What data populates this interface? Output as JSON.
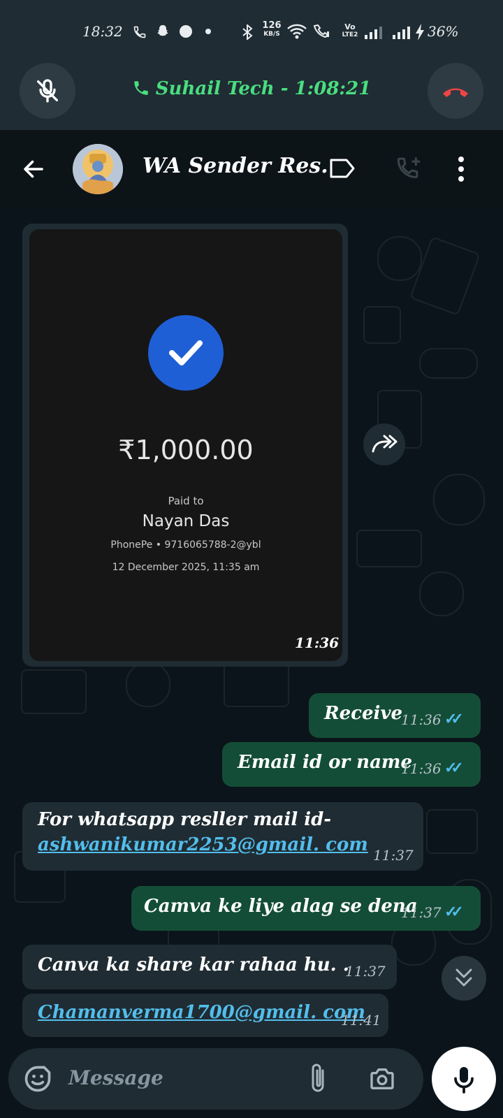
{
  "status_bar": {
    "time": "18:32",
    "net_speed_top": "126",
    "net_speed_unit": "KB/S",
    "volte_top": "Vo",
    "volte_bottom": "LTE2",
    "battery": "36%"
  },
  "call_banner": {
    "label": "Suhail Tech - 1:08:21"
  },
  "app_bar": {
    "title": "WA Sender Res."
  },
  "receipt": {
    "amount": "₹1,000.00",
    "paid_to_label": "Paid to",
    "payee": "Nayan Das",
    "upi": "PhonePe • 9716065788-2@ybl",
    "datetime": "12 December 2025, 11:35 am",
    "time": "11:36"
  },
  "messages": [
    {
      "direction": "out",
      "text": "Receive",
      "time": "11:36",
      "status": "read"
    },
    {
      "direction": "out",
      "text": "Email id or name",
      "time": "11:36",
      "status": "read"
    },
    {
      "direction": "in",
      "text": "For whatsapp resller mail id-",
      "link": "ashwanikumar2253@gmail. com",
      "time": "11:37"
    },
    {
      "direction": "out",
      "text": "Camva ke liye alag se dena",
      "time": "11:37",
      "status": "read"
    },
    {
      "direction": "in",
      "text": "Canva ka share kar rahaa hu. .",
      "time": "11:37"
    },
    {
      "direction": "in",
      "link": "Chamanverma1700@gmail. com",
      "time": "11:41"
    }
  ],
  "input": {
    "placeholder": "Message"
  },
  "colors": {
    "incoming_bubble": "#1f2c33",
    "outgoing_bubble": "#144d37",
    "read_ticks": "#53bdeb",
    "call_green": "#4ade80",
    "end_call_red": "#ef4444",
    "upi_check_blue": "#1f5fd6"
  },
  "icons": [
    "mic-off-icon",
    "phone-icon",
    "end-call-icon",
    "back-arrow-icon",
    "avatar",
    "label-icon",
    "add-call-icon",
    "more-vert-icon",
    "check-icon",
    "forward-icon",
    "scroll-down-icon",
    "sticker-icon",
    "attach-icon",
    "camera-icon",
    "mic-icon"
  ]
}
